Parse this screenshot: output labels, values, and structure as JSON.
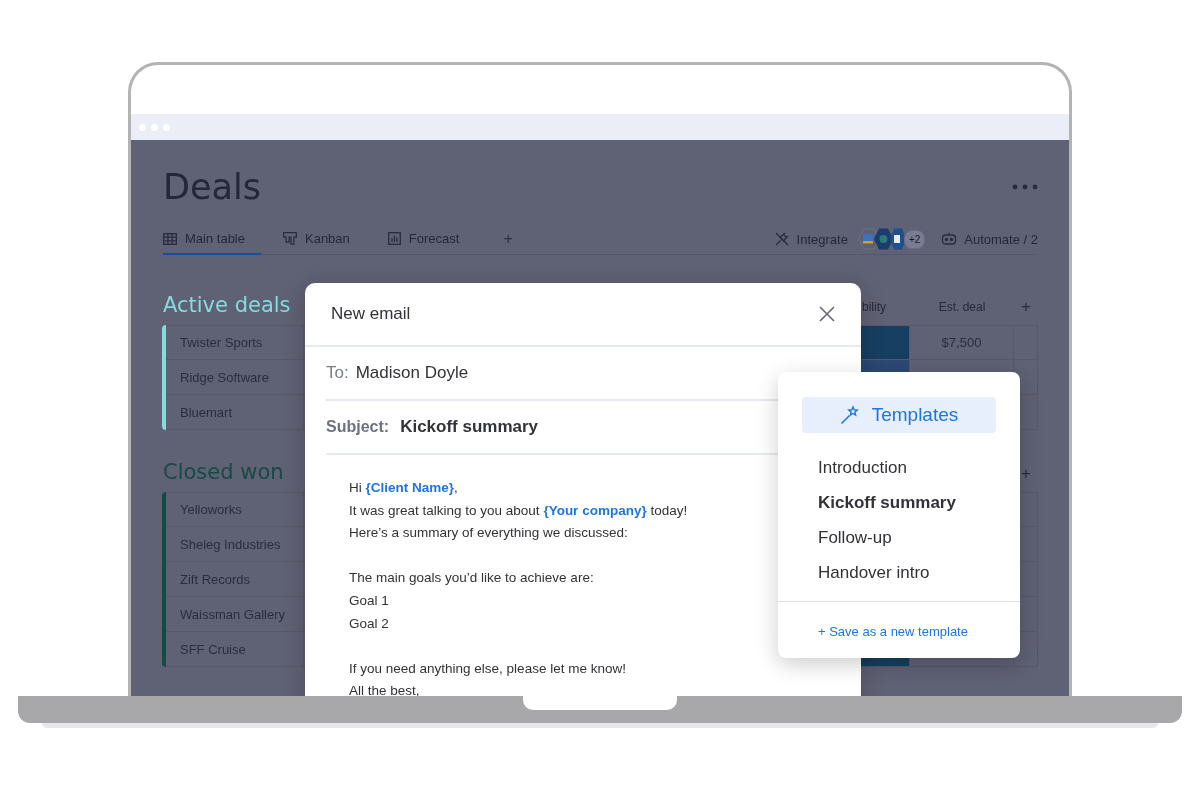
{
  "board": {
    "title": "Deals"
  },
  "tabs": [
    {
      "label": "Main table",
      "selected": true
    },
    {
      "label": "Kanban",
      "selected": false
    },
    {
      "label": "Forecast",
      "selected": false
    }
  ],
  "add_view": "+",
  "toolbar": {
    "integrate": "Integrate",
    "more_apps": "+2",
    "automate": "Automate / 2"
  },
  "groups": [
    {
      "title": "Active deals",
      "color": "#86dcdc",
      "columns": [
        "bility",
        "Est. deal"
      ],
      "add_column": "+",
      "rows": [
        {
          "name": "Twister Sports",
          "color": "#173f61",
          "est_deal": "$7,500"
        },
        {
          "name": "Ridge Software",
          "color": "#2d4874"
        },
        {
          "name": "Bluemart"
        }
      ]
    },
    {
      "title": "Closed won",
      "color": "#184a45",
      "add_column": "+",
      "rows": [
        {
          "name": "Yelloworks"
        },
        {
          "name": "Sheleg Industries"
        },
        {
          "name": "Zift Records"
        },
        {
          "name": "Waissman Gallery"
        },
        {
          "name": "SFF Cruise",
          "color": "#173f61"
        }
      ]
    }
  ],
  "email": {
    "title": "New email",
    "to_label": "To:",
    "to": "Madison Doyle",
    "subject_label": "Subject:",
    "subject": "Kickoff summary",
    "paragraphs": [
      [
        [
          {
            "kind": "text",
            "text": "Hi "
          },
          {
            "kind": "variable",
            "text": "{Client Name}"
          },
          {
            "kind": "text",
            "text": ","
          }
        ],
        [
          {
            "kind": "text",
            "text": "It was great talking to you about "
          },
          {
            "kind": "variable",
            "text": "{Your company}"
          },
          {
            "kind": "text",
            "text": " today!"
          }
        ],
        [
          {
            "kind": "text",
            "text": "Here’s a summary of everything we discussed:"
          }
        ]
      ],
      [
        [
          {
            "kind": "text",
            "text": "The main goals you’d like to achieve are:"
          }
        ],
        [
          {
            "kind": "text",
            "text": "Goal 1"
          }
        ],
        [
          {
            "kind": "text",
            "text": "Goal 2"
          }
        ]
      ],
      [
        [
          {
            "kind": "text",
            "text": "If you need anything else, please let me know!"
          }
        ],
        [
          {
            "kind": "text",
            "text": "All the best,"
          }
        ]
      ]
    ]
  },
  "templates": {
    "button": "Templates",
    "items": [
      {
        "label": "Introduction",
        "selected": false
      },
      {
        "label": "Kickoff summary",
        "selected": true
      },
      {
        "label": "Follow-up",
        "selected": false
      },
      {
        "label": "Handover intro",
        "selected": false
      }
    ],
    "save_link": "+ Save as a new template"
  }
}
